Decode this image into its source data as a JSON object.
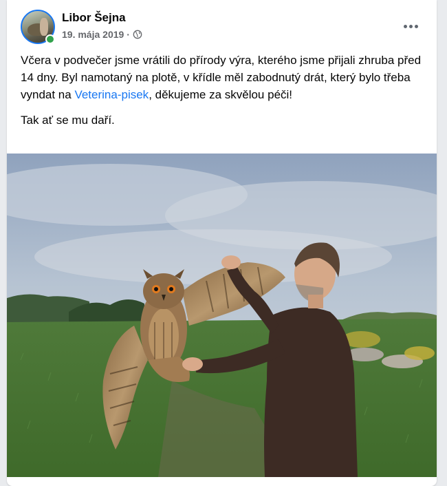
{
  "post": {
    "author": "Libor Šejna",
    "date": "19. mája 2019",
    "separator": "·",
    "privacy_icon": "globe-icon",
    "more_icon": "more-options-icon",
    "paragraph1_before_link": "Včera v podvečer jsme vrátili do přírody výra, kterého jsme přijali zhruba před 14 dny. Byl namotaný na plotě, v křídle měl zabodnutý drát, který bylo třeba vyndat na ",
    "link_text": "Veterina-pisek",
    "paragraph1_after_link": ", děkujeme za skvělou péči!",
    "paragraph2": "Tak ať se mu daří."
  },
  "colors": {
    "link": "#1877f2",
    "online": "#31a24c",
    "text": "#050505",
    "meta": "#65676b"
  }
}
